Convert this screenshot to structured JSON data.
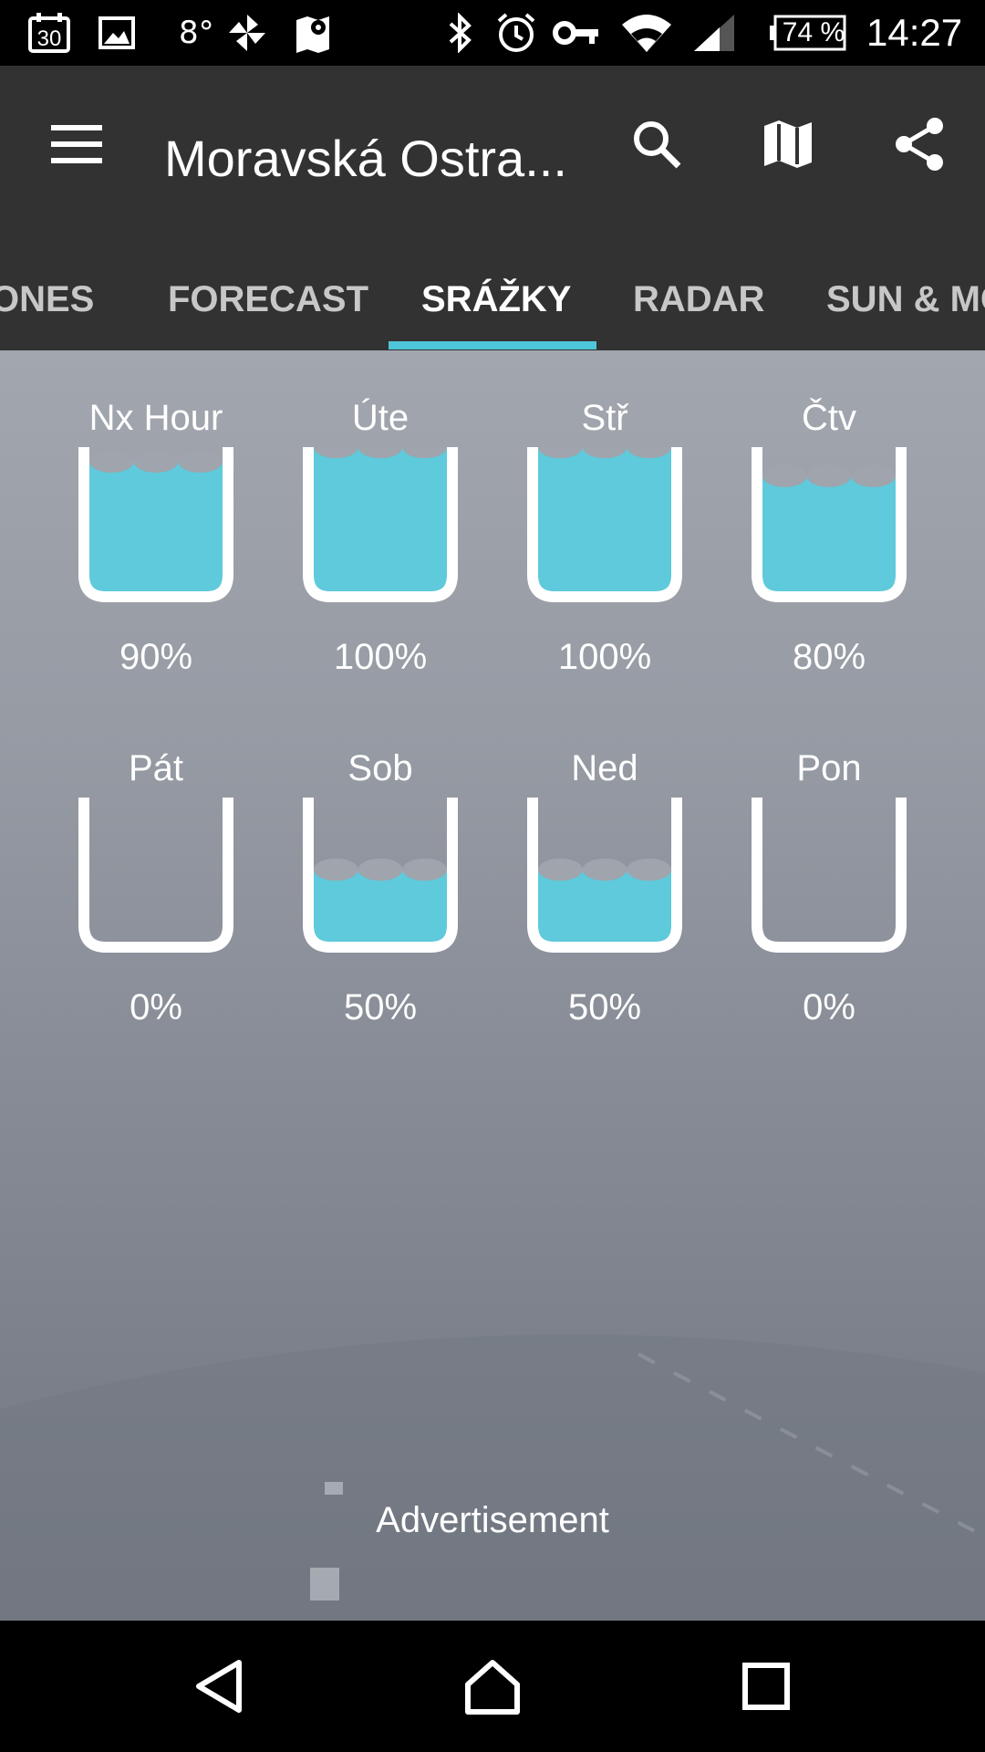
{
  "status_bar": {
    "calendar_day": "30",
    "temperature": "8°",
    "battery": "74 %",
    "time": "14:27",
    "icons": [
      "calendar-icon",
      "image-icon",
      "pinwheel-icon",
      "map-icon",
      "bluetooth-icon",
      "alarm-icon",
      "vpn-key-icon",
      "wifi-icon",
      "signal-icon",
      "battery-icon"
    ]
  },
  "app_bar": {
    "title": "Moravská Ostra...",
    "menu_icon": "menu-icon",
    "search_icon": "search-icon",
    "map_icon": "map-icon",
    "share_icon": "share-icon"
  },
  "tabs": {
    "items": [
      "ONES",
      "FORECAST",
      "SRÁŽKY",
      "RADAR",
      "SUN & MO"
    ],
    "active_index": 2,
    "accent_color": "#4fc6d8"
  },
  "precipitation": {
    "fill_color": "#5ecadb",
    "items": [
      {
        "day": "Nx Hour",
        "percent_label": "90%",
        "value": 90
      },
      {
        "day": "Úte",
        "percent_label": "100%",
        "value": 100
      },
      {
        "day": "Stř",
        "percent_label": "100%",
        "value": 100
      },
      {
        "day": "Čtv",
        "percent_label": "80%",
        "value": 80
      },
      {
        "day": "Pát",
        "percent_label": "0%",
        "value": 0
      },
      {
        "day": "Sob",
        "percent_label": "50%",
        "value": 50
      },
      {
        "day": "Ned",
        "percent_label": "50%",
        "value": 50
      },
      {
        "day": "Pon",
        "percent_label": "0%",
        "value": 0
      }
    ]
  },
  "ad": {
    "label": "Advertisement"
  },
  "nav_bar": {
    "icons": [
      "back-icon",
      "home-icon",
      "recents-icon"
    ]
  }
}
